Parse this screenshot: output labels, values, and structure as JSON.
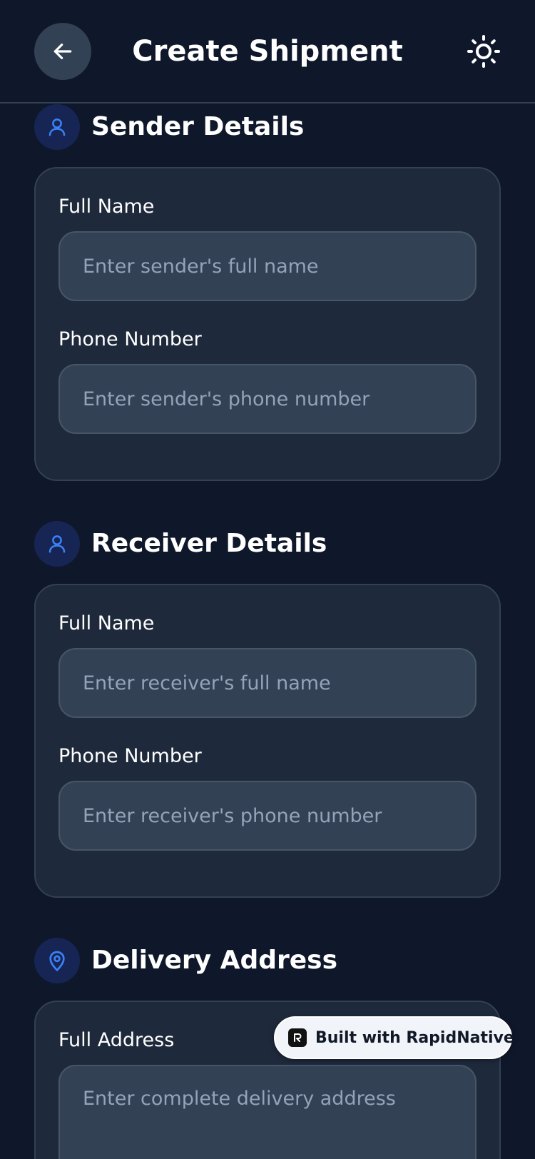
{
  "header": {
    "title": "Create Shipment",
    "back_icon": "arrow-left-icon",
    "theme_icon": "sun-icon"
  },
  "sections": {
    "sender": {
      "title": "Sender Details",
      "icon": "user-icon",
      "name_label": "Full Name",
      "name_placeholder": "Enter sender's full name",
      "phone_label": "Phone Number",
      "phone_placeholder": "Enter sender's phone number"
    },
    "receiver": {
      "title": "Receiver Details",
      "icon": "user-icon",
      "name_label": "Full Name",
      "name_placeholder": "Enter receiver's full name",
      "phone_label": "Phone Number",
      "phone_placeholder": "Enter receiver's phone number"
    },
    "delivery": {
      "title": "Delivery Address",
      "icon": "map-pin-icon",
      "address_label": "Full Address",
      "address_placeholder": "Enter complete delivery address"
    }
  },
  "badge": {
    "text": "Built with RapidNative"
  },
  "colors": {
    "background": "#0f172a",
    "card": "#1e293b",
    "input": "#334155",
    "accent": "#3b82f6",
    "placeholder": "#94a3b8"
  }
}
